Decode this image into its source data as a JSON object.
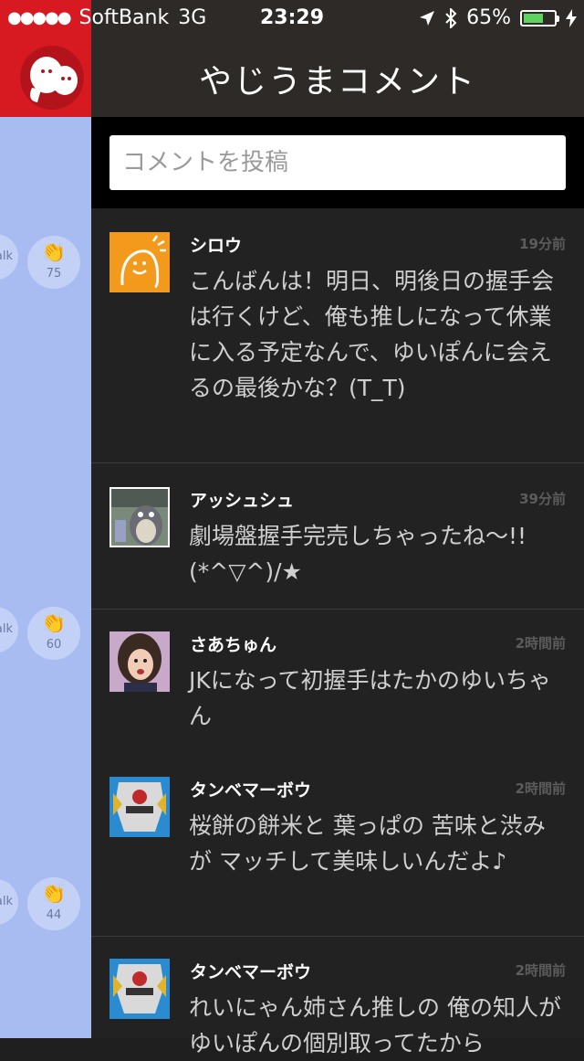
{
  "status_bar": {
    "carrier": "SoftBank",
    "network": "3G",
    "time": "23:29",
    "battery": "65%",
    "battery_level": 0.65,
    "signal_dots": "●●●●●"
  },
  "nav": {
    "title": "やじうまコメント"
  },
  "composer": {
    "placeholder": "コメントを投稿"
  },
  "side": {
    "talk_label": "alk",
    "clap_counts": [
      "75",
      "60",
      "44"
    ]
  },
  "comments": [
    {
      "name": "シロウ",
      "time": "19分前",
      "text": "こんばんは！明日、明後日の握手会は行くけど、俺も推しになって休業に入る予定なんで、ゆいぽんに会えるの最後かな？(T_T)"
    },
    {
      "name": "アッシュシュ",
      "time": "39分前",
      "text": "劇場盤握手完売しちゃったね〜!!(*^▽^)/★"
    },
    {
      "name": "さあちゅん",
      "time": "2時間前",
      "text": "JKになって初握手はたかのゆいちゃん"
    },
    {
      "name": "タンベマーボウ",
      "time": "2時間前",
      "text": "桜餅の餅米と 葉っぱの 苦味と渋みが マッチして美味しいんだよ♪"
    },
    {
      "name": "タンベマーボウ",
      "time": "2時間前",
      "text": "れいにゃん姉さん推しの 俺の知人がゆいぽんの個別取ってたから"
    }
  ],
  "colors": {
    "brand_red": "#d71921",
    "side_blue": "#a9bcf2",
    "nav_bg": "#2e2a28",
    "list_bg": "#222222",
    "battery_green": "#5fd35f"
  }
}
